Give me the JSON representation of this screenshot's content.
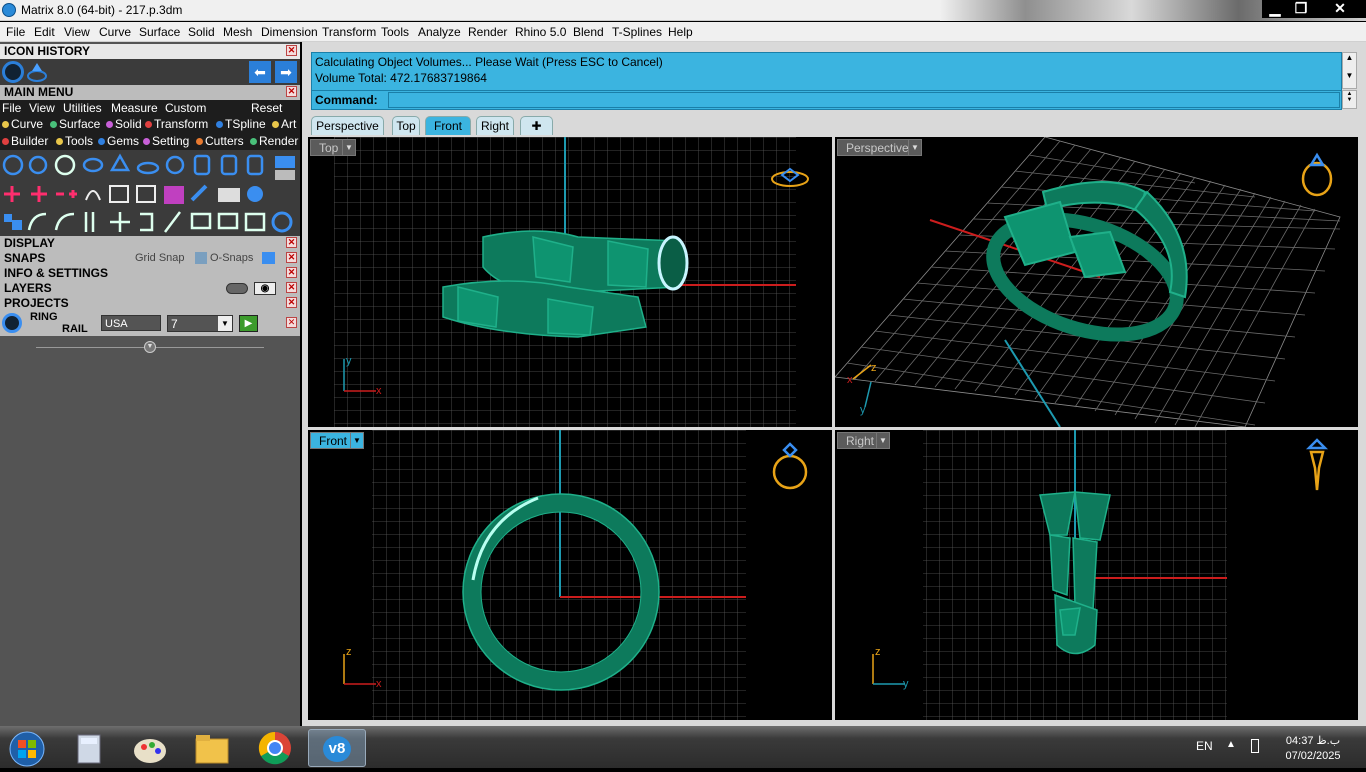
{
  "window": {
    "title": "Matrix 8.0 (64-bit) - 217.p.3dm",
    "min": "▁",
    "max": "❐",
    "close": "✕"
  },
  "menu": [
    "File",
    "Edit",
    "View",
    "Curve",
    "Surface",
    "Solid",
    "Mesh",
    "Dimension",
    "Transform",
    "Tools",
    "Analyze",
    "Render",
    "Rhino 5.0",
    "Blend",
    "T-Splines",
    "Help"
  ],
  "panel": {
    "icon_history": "ICON HISTORY",
    "main_menu": "MAIN MENU",
    "mm_items": [
      "File",
      "View",
      "Utilities",
      "Measure",
      "Custom",
      "Reset"
    ],
    "cats1": [
      "Curve",
      "Surface",
      "Solid",
      "Transform",
      "TSpline",
      "Art"
    ],
    "cats2": [
      "Builder",
      "Tools",
      "Gems",
      "Setting",
      "Cutters",
      "Render"
    ],
    "display": "DISPLAY",
    "snaps": "SNAPS",
    "grid_snap": "Grid Snap",
    "osnaps": "O-Snaps",
    "info": "INFO & SETTINGS",
    "layers": "LAYERS",
    "projects": "PROJECTS",
    "ring_rail_1": "RING",
    "ring_rail_2": "RAIL",
    "country": "USA",
    "size": "7"
  },
  "command": {
    "line1": "Calculating Object Volumes... Please Wait (Press ESC to Cancel)",
    "line2": "Volume Total: 472.17683719864",
    "label": "Command:"
  },
  "tabs": [
    "Perspective",
    "Top",
    "Front",
    "Right",
    "✚"
  ],
  "viewports": {
    "top": "Top",
    "perspective": "Perspective",
    "front": "Front",
    "right": "Right"
  },
  "axes": {
    "x": "x",
    "y": "y",
    "z": "z"
  },
  "taskbar": {
    "lang": "EN",
    "time": "04:37 ب.ظ",
    "date": "07/02/2025",
    "app": "v8"
  },
  "colors": {
    "accent": "#3bb4e0",
    "model": "#0d8060",
    "x_axis": "#cc1d1d",
    "y_axis": "#1d9ab0"
  }
}
